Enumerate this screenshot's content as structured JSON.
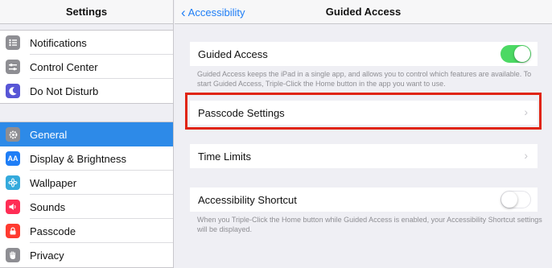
{
  "sidebar": {
    "title": "Settings",
    "group1": [
      {
        "label": "Notifications",
        "icon": "notifications-icon",
        "color": "#8e8e93"
      },
      {
        "label": "Control Center",
        "icon": "control-center-icon",
        "color": "#8e8e93"
      },
      {
        "label": "Do Not Disturb",
        "icon": "moon-icon",
        "color": "#5856d6"
      }
    ],
    "group2": [
      {
        "label": "General",
        "icon": "gear-icon",
        "color": "#8e8e93",
        "selected": true
      },
      {
        "label": "Display & Brightness",
        "icon": "display-brightness-icon",
        "color": "#1f7ef6",
        "glyph": "AA"
      },
      {
        "label": "Wallpaper",
        "icon": "wallpaper-icon",
        "color": "#34aadc"
      },
      {
        "label": "Sounds",
        "icon": "speaker-icon",
        "color": "#ff2d55"
      },
      {
        "label": "Passcode",
        "icon": "lock-icon",
        "color": "#ff3b30"
      },
      {
        "label": "Privacy",
        "icon": "hand-icon",
        "color": "#8e8e93"
      }
    ]
  },
  "detail": {
    "back_label": "Accessibility",
    "title": "Guided Access",
    "guided_access": {
      "label": "Guided Access",
      "on": true,
      "footnote": "Guided Access keeps the iPad in a single app, and allows you to control which features are available. To start Guided Access, Triple-Click the Home button in the app you want to use."
    },
    "passcode_settings": "Passcode Settings",
    "time_limits": "Time Limits",
    "shortcut": {
      "label": "Accessibility Shortcut",
      "on": false,
      "footnote": "When you Triple-Click the Home button while Guided Access is enabled, your Accessibility Shortcut settings will be displayed."
    }
  },
  "colors": {
    "accent": "#1f7ef6",
    "selected_row": "#2d8ae8",
    "toggle_on": "#4cd964",
    "highlight": "#e0240f"
  }
}
